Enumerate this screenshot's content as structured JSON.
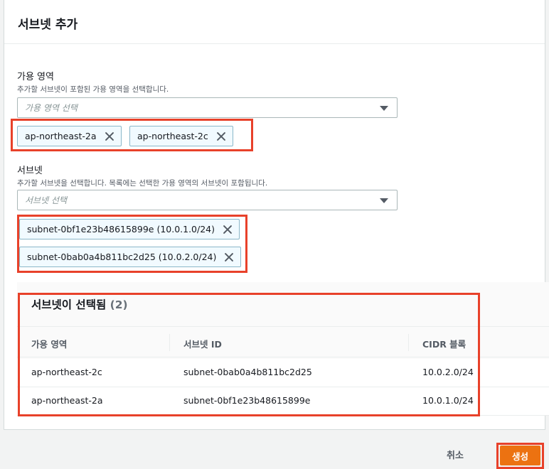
{
  "modal": {
    "title": "서브넷 추가"
  },
  "availability_zone": {
    "label": "가용 영역",
    "description": "추가할 서브넷이 포함된 가용 영역을 선택합니다.",
    "placeholder": "가용 영역 선택",
    "selected": [
      "ap-northeast-2a",
      "ap-northeast-2c"
    ]
  },
  "subnet": {
    "label": "서브넷",
    "description": "추가할 서브넷을 선택합니다. 목록에는 선택한 가용 영역의 서브넷이 포함됩니다.",
    "placeholder": "서브넷 선택",
    "selected": [
      "subnet-0bf1e23b48615899e (10.0.1.0/24)",
      "subnet-0bab0a4b811bc2d25 (10.0.2.0/24)"
    ]
  },
  "selected_table": {
    "title": "서브넷이 선택됨",
    "count": "(2)",
    "columns": [
      "가용 영역",
      "서브넷 ID",
      "CIDR 블록"
    ],
    "rows": [
      [
        "ap-northeast-2c",
        "subnet-0bab0a4b811bc2d25",
        "10.0.2.0/24"
      ],
      [
        "ap-northeast-2a",
        "subnet-0bf1e23b48615899e",
        "10.0.1.0/24"
      ]
    ]
  },
  "footer": {
    "cancel_label": "취소",
    "create_label": "생성"
  },
  "colors": {
    "highlight": "#e8412a",
    "primary_button": "#ec7211",
    "token_border": "#8ab7c9"
  }
}
